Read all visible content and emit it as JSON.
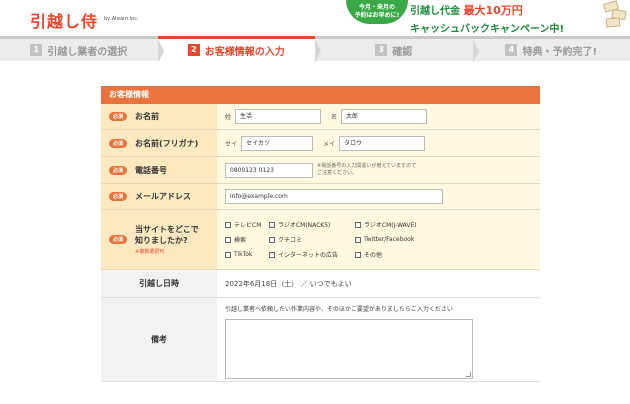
{
  "header": {
    "logo": "引越し侍",
    "logo_sub": "by Ateam Inc.",
    "promo_badge_line1": "今月・来月の",
    "promo_badge_line2": "予約はお早めに!",
    "promo_line1_a": "引越し代金",
    "promo_line1_b": "最大10万円",
    "promo_line2": "キャッシュバックキャンペーン中!"
  },
  "steps": [
    {
      "num": "1",
      "label": "引越し業者の選択"
    },
    {
      "num": "2",
      "label": "お客様情報の入力"
    },
    {
      "num": "3",
      "label": "確認"
    },
    {
      "num": "4",
      "label": "特典・予約完了!"
    }
  ],
  "form": {
    "section_title": "お客様情報",
    "required_badge": "必須",
    "name": {
      "label": "お名前",
      "last_prefix": "姓",
      "last_value": "生活",
      "first_prefix": "名",
      "first_value": "太郎"
    },
    "kana": {
      "label": "お名前(フリガナ)",
      "last_prefix": "セイ",
      "last_value": "セイカツ",
      "first_prefix": "メイ",
      "first_value": "タロウ"
    },
    "phone": {
      "label": "電話番号",
      "value": "0800123 0123",
      "note_line1": "※電話番号の入力間違いが増えていますので",
      "note_line2": "ご注意ください。"
    },
    "email": {
      "label": "メールアドレス",
      "value": "info@example.com"
    },
    "source": {
      "label_line1": "当サイトをどこで",
      "label_line2": "知りましたか?",
      "multi_note": "※複数選択可",
      "options": [
        "テレビCM",
        "ラジオCM(NACK5)",
        "ラジオCM(J-WAVE)",
        "検索",
        "クチコミ",
        "Twitter/Facebook",
        "TikTok",
        "インターネットの広告",
        "その他"
      ]
    },
    "move_date": {
      "label": "引越し日時",
      "value": "2022年6月18日（土） ／ いつでもよい"
    },
    "remarks": {
      "label": "備考",
      "hint": "引越し業者へ依頼したい作業内容や、そのほかご要望がありましたらご入力ください"
    }
  },
  "colors": {
    "brand": "#e8472c",
    "accent": "#e8743b",
    "label_bg": "#fce9c0",
    "field_bg": "#fff9df"
  }
}
